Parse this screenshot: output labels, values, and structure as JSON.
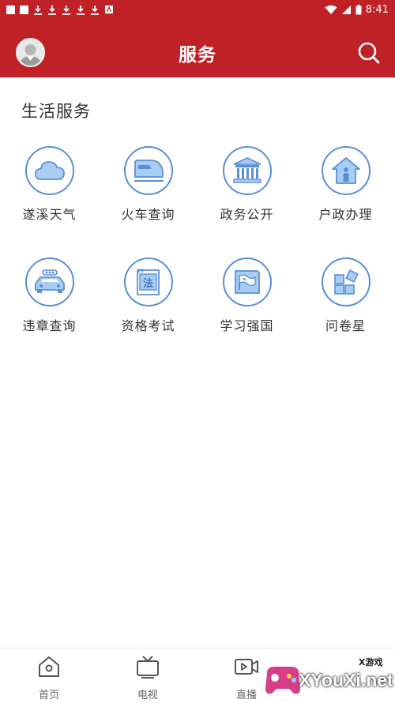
{
  "status_bar": {
    "time": "8:41"
  },
  "header": {
    "title": "服务"
  },
  "section": {
    "title": "生活服务"
  },
  "services": [
    {
      "label": "遂溪天气",
      "icon": "cloud-icon"
    },
    {
      "label": "火车查询",
      "icon": "train-icon"
    },
    {
      "label": "政务公开",
      "icon": "government-building-icon"
    },
    {
      "label": "户政办理",
      "icon": "household-house-icon"
    },
    {
      "label": "违章查询",
      "icon": "car-icon"
    },
    {
      "label": "资格考试",
      "icon": "law-book-icon"
    },
    {
      "label": "学习强国",
      "icon": "study-flag-icon"
    },
    {
      "label": "问卷星",
      "icon": "questionnaire-blocks-icon"
    }
  ],
  "bottom_nav": [
    {
      "label": "首页",
      "icon": "home-icon"
    },
    {
      "label": "电视",
      "icon": "tv-icon"
    },
    {
      "label": "直播",
      "icon": "video-camera-icon"
    }
  ],
  "watermark": {
    "text": "XYouXi.net",
    "small": "X游戏"
  },
  "colors": {
    "primary": "#bf2126",
    "icon_blue": "#5a8fd8",
    "icon_fill": "#a9cdf2"
  }
}
